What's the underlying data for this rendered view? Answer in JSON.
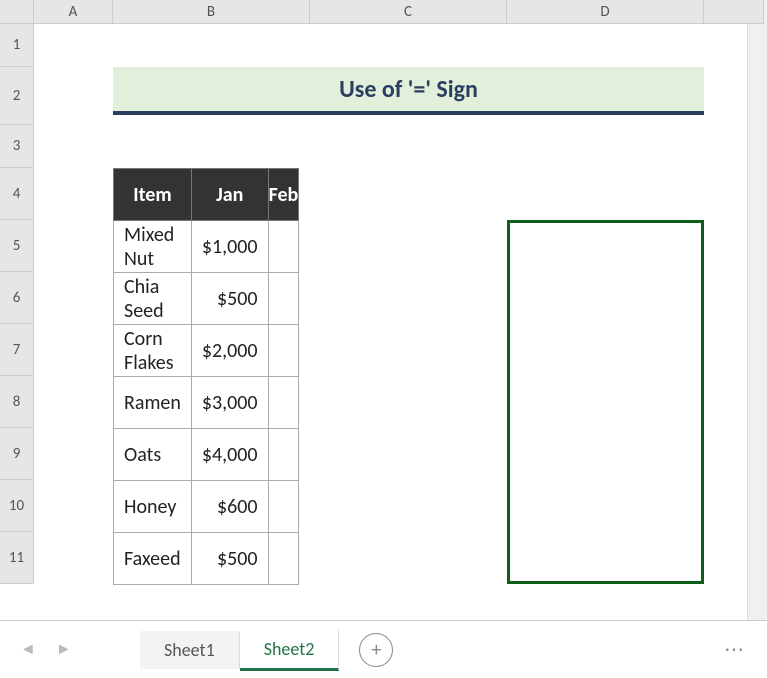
{
  "columns": [
    "A",
    "B",
    "C",
    "D"
  ],
  "rows": [
    "1",
    "2",
    "3",
    "4",
    "5",
    "6",
    "7",
    "8",
    "9",
    "10",
    "11"
  ],
  "title": "Use of '=' Sign",
  "table": {
    "headers": {
      "item": "Item",
      "jan": "Jan",
      "feb": "Feb"
    },
    "rows": [
      {
        "item": "Mixed Nut",
        "jan": "$1,000",
        "feb": ""
      },
      {
        "item": "Chia Seed",
        "jan": "$500",
        "feb": ""
      },
      {
        "item": "Corn Flakes",
        "jan": "$2,000",
        "feb": ""
      },
      {
        "item": "Ramen",
        "jan": "$3,000",
        "feb": ""
      },
      {
        "item": "Oats",
        "jan": "$4,000",
        "feb": ""
      },
      {
        "item": "Honey",
        "jan": "$600",
        "feb": ""
      },
      {
        "item": "Faxeed",
        "jan": "$500",
        "feb": ""
      }
    ]
  },
  "sheets": {
    "tab1": "Sheet1",
    "tab2": "Sheet2"
  },
  "add_sheet_label": "+",
  "chart_data": {
    "type": "table",
    "title": "Use of '=' Sign",
    "columns": [
      "Item",
      "Jan",
      "Feb"
    ],
    "rows": [
      [
        "Mixed Nut",
        1000,
        null
      ],
      [
        "Chia Seed",
        500,
        null
      ],
      [
        "Corn Flakes",
        2000,
        null
      ],
      [
        "Ramen",
        3000,
        null
      ],
      [
        "Oats",
        4000,
        null
      ],
      [
        "Honey",
        600,
        null
      ],
      [
        "Faxeed",
        500,
        null
      ]
    ]
  }
}
